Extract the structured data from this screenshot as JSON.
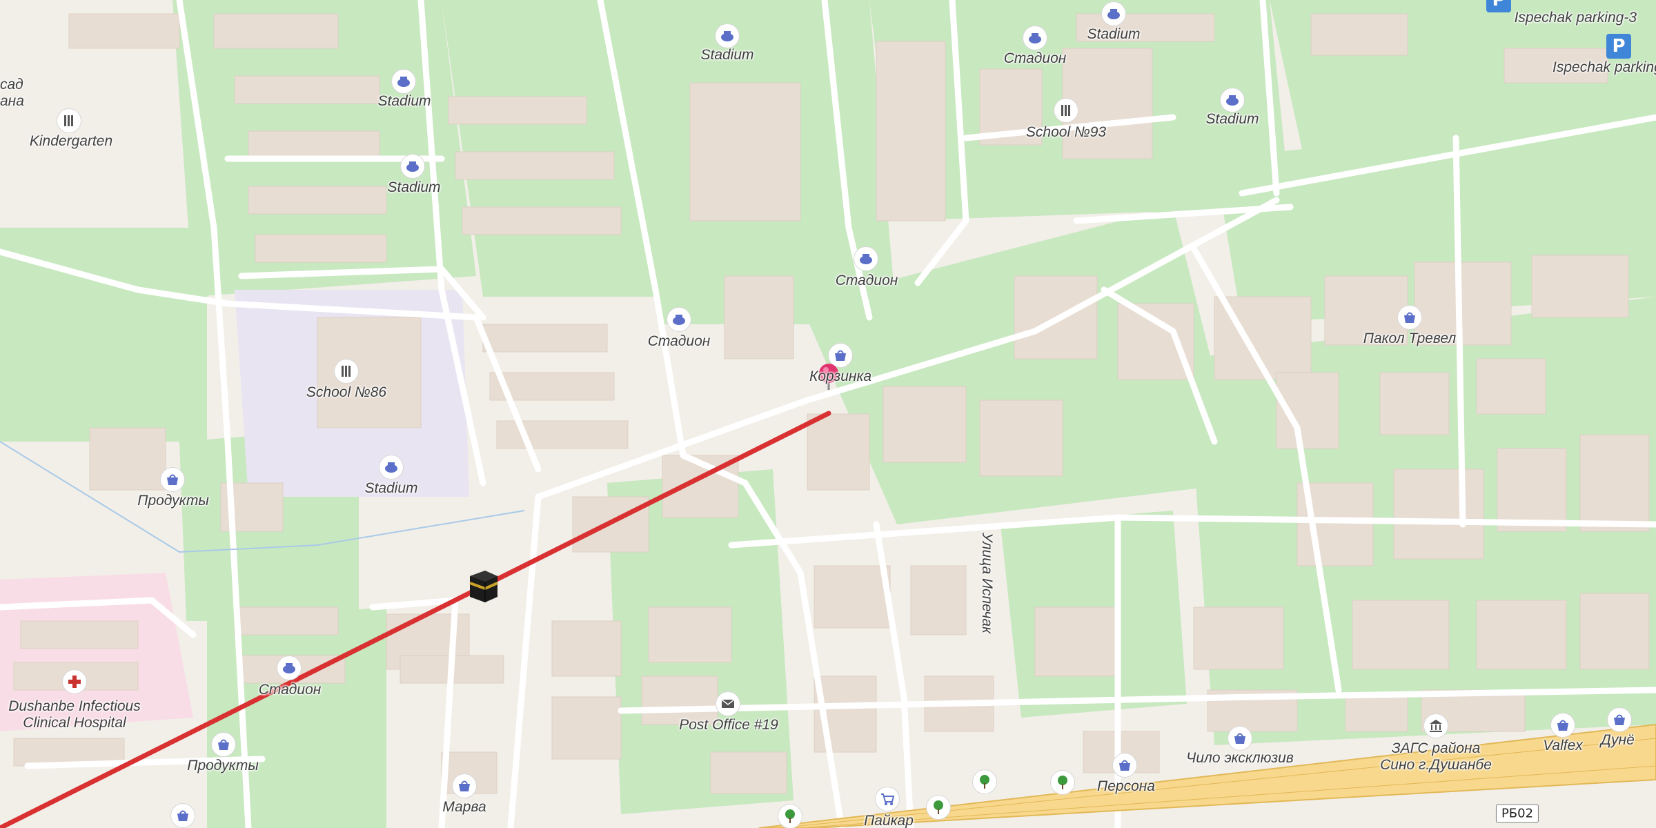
{
  "map": {
    "colors": {
      "background": "#f2efe9",
      "green": "#c8e8c0",
      "building": "#e8ddd3",
      "road": "#ffffff",
      "school_area": "#e9e4f2",
      "hospital_area": "#f9dde6",
      "route": "#d93031",
      "pin": "#e2356f",
      "poi_icon": "#5b6fc9",
      "parking": "#3f86d8",
      "highway": "#f7d88d"
    },
    "labels": {
      "kindergarten_partial": "сад\nана",
      "kindergarten": "Kindergarten",
      "stadium_1": "Stadium",
      "stadium_2": "Stadium",
      "stadium_3": "Stadium",
      "stadium_4": "Stadium",
      "stadium_5": "Stadium",
      "stadium_6": "Stadium",
      "stadion_1": "Стадион",
      "stadion_2": "Стадион",
      "stadion_3": "Стадион",
      "stadion_4": "Стадион",
      "school_93": "School №93",
      "school_86": "School №86",
      "ispechak_parking_3": "Ispechak parking-3",
      "ispechak_parking": "Ispechak parking",
      "korzinka": "Корзинка",
      "pakol_trevel": "Пакол Тревел",
      "produkty_1": "Продукты",
      "produkty_2": "Продукты",
      "street_ispechak": "Улица Испечак",
      "hospital": "Dushanbe Infectious\nClinical Hospital",
      "post_office": "Post Office #19",
      "marva": "Марва",
      "persona": "Персона",
      "chilo": "Чило эксклюзив",
      "zags": "ЗАГС района\nСино г.Душанбе",
      "valfex": "Valfex",
      "dune": "Дунё",
      "paykar": "Пайкар",
      "road_shield": "РБ02"
    },
    "route": {
      "description_color": "#d93031"
    }
  }
}
